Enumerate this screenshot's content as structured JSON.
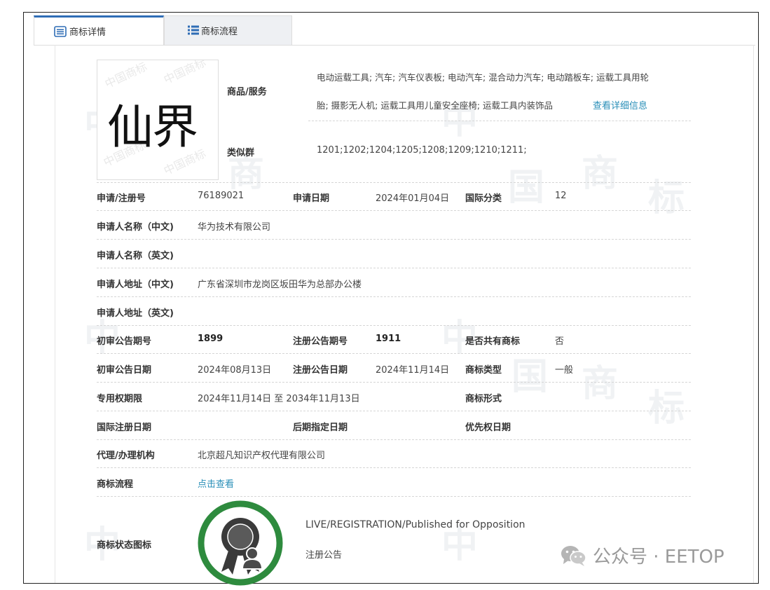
{
  "tabs": [
    {
      "label": "商标详情",
      "icon": "document-list-icon",
      "active": true
    },
    {
      "label": "商标流程",
      "icon": "list-icon",
      "active": false
    }
  ],
  "mark": {
    "text": "仙界",
    "watermark": "中国商标"
  },
  "goods": {
    "label": "商品/服务",
    "line1": "电动运载工具; 汽车; 汽车仪表板; 电动汽车; 混合动力汽车; 电动踏板车; 运载工具用轮",
    "line2": "胎; 摄影无人机; 运载工具用儿童安全座椅; 运载工具内装饰品",
    "detail_link": "查看详细信息"
  },
  "similar_group": {
    "label": "类似群",
    "value": "1201;1202;1204;1205;1208;1209;1210;1211;"
  },
  "fields": {
    "reg_no": {
      "label": "申请/注册号",
      "value": "76189021"
    },
    "app_date": {
      "label": "申请日期",
      "value": "2024年01月04日"
    },
    "intl_class": {
      "label": "国际分类",
      "value": "12"
    },
    "applicant_cn": {
      "label": "申请人名称（中文)",
      "value": "华为技术有限公司"
    },
    "applicant_en": {
      "label": "申请人名称（英文)",
      "value": ""
    },
    "address_cn": {
      "label": "申请人地址（中文)",
      "value": "广东省深圳市龙岗区坂田华为总部办公楼"
    },
    "address_en": {
      "label": "申请人地址（英文)",
      "value": ""
    },
    "prelim_no": {
      "label": "初审公告期号",
      "value": "1899"
    },
    "reg_notice_no": {
      "label": "注册公告期号",
      "value": "1911"
    },
    "shared": {
      "label": "是否共有商标",
      "value": "否"
    },
    "prelim_date": {
      "label": "初审公告日期",
      "value": "2024年08月13日"
    },
    "reg_notice_date": {
      "label": "注册公告日期",
      "value": "2024年11月14日"
    },
    "mark_type": {
      "label": "商标类型",
      "value": "一般"
    },
    "exclusive_period": {
      "label": "专用权期限",
      "value": "2024年11月14日 至 2034年11月13日"
    },
    "mark_form": {
      "label": "商标形式",
      "value": ""
    },
    "intl_reg_date": {
      "label": "国际注册日期",
      "value": ""
    },
    "later_date": {
      "label": "后期指定日期",
      "value": ""
    },
    "priority_date": {
      "label": "优先权日期",
      "value": ""
    },
    "agent": {
      "label": "代理/办理机构",
      "value": "北京超凡知识产权代理有限公司"
    },
    "process": {
      "label": "商标流程",
      "value": "点击查看"
    },
    "status_icon": {
      "label": "商标状态图标",
      "status_en": "LIVE/REGISTRATION/Published for Opposition",
      "status_cn": "注册公告"
    }
  },
  "wechat": {
    "text": "公众号 · EETOP",
    "icon": "wechat-icon"
  },
  "colors": {
    "accent": "#2f6db5",
    "link": "#2a8fb8",
    "badge_green": "#2e8b3e",
    "badge_dark": "#3a3a3a"
  }
}
